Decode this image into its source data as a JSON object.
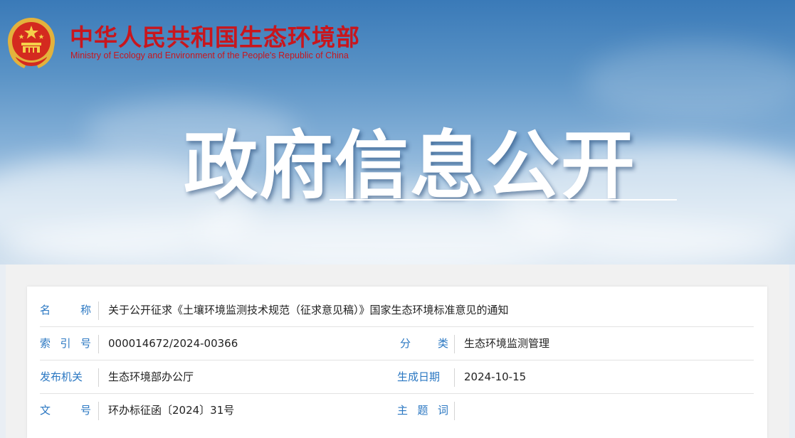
{
  "header": {
    "org_name_cn": "中华人民共和国生态环境部",
    "org_name_en": "Ministry of Ecology and Environment of the People's Republic of China",
    "section_title": "政府信息公开"
  },
  "info": {
    "name": {
      "label": [
        "名",
        "称"
      ],
      "value": "关于公开征求《土壤环境监测技术规范（征求意见稿）》国家生态环境标准意见的通知"
    },
    "index_no": {
      "label": [
        "索",
        "引",
        "号"
      ],
      "value": "000014672/2024-00366"
    },
    "category": {
      "label": [
        "分",
        "类"
      ],
      "value": "生态环境监测管理"
    },
    "issuer": {
      "label": "发布机关",
      "value": "生态环境部办公厅"
    },
    "date": {
      "label": "生成日期",
      "value": "2024-10-15"
    },
    "doc_no": {
      "label": [
        "文",
        "号"
      ],
      "value": "环办标征函〔2024〕31号"
    },
    "subject": {
      "label": [
        "主",
        "题",
        "词"
      ],
      "value": ""
    }
  },
  "colors": {
    "brand_red": "#c8161d",
    "label_blue": "#2a77c2",
    "sky_blue": "#3a7ab8"
  }
}
